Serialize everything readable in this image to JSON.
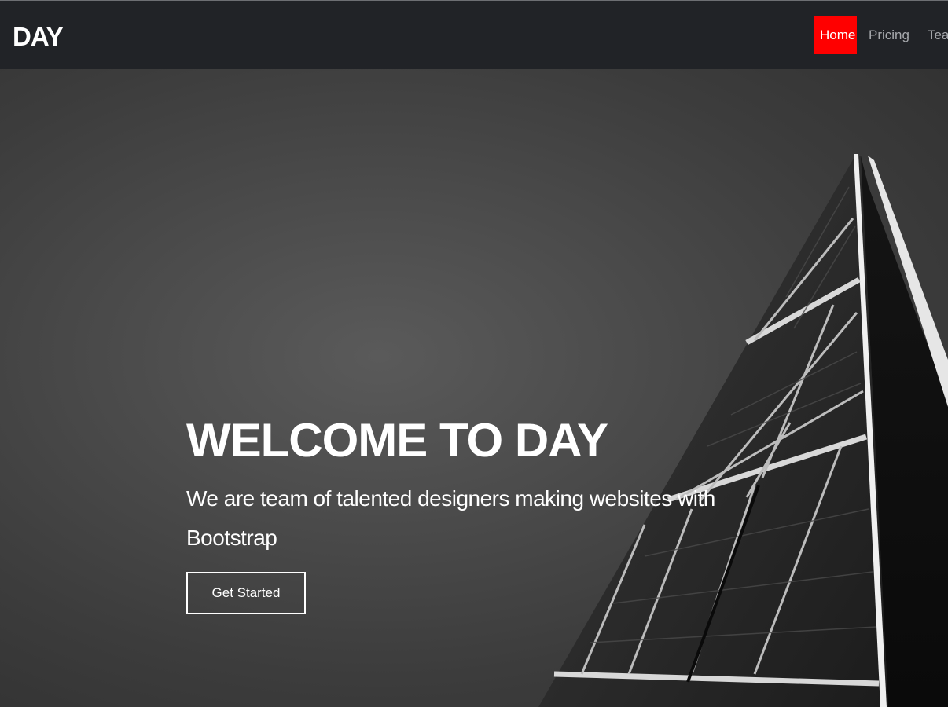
{
  "navbar": {
    "brand": "DAY",
    "links": [
      {
        "label": "Home",
        "active": true
      },
      {
        "label": "Pricing",
        "active": false
      },
      {
        "label": "Team",
        "active": false
      }
    ]
  },
  "hero": {
    "title": "WELCOME TO DAY",
    "subtitle": "We are team of talented designers making websites with Bootstrap",
    "cta_label": "Get Started"
  },
  "colors": {
    "nav_background": "#212327",
    "active_link": "#ff0000",
    "text": "#ffffff"
  }
}
